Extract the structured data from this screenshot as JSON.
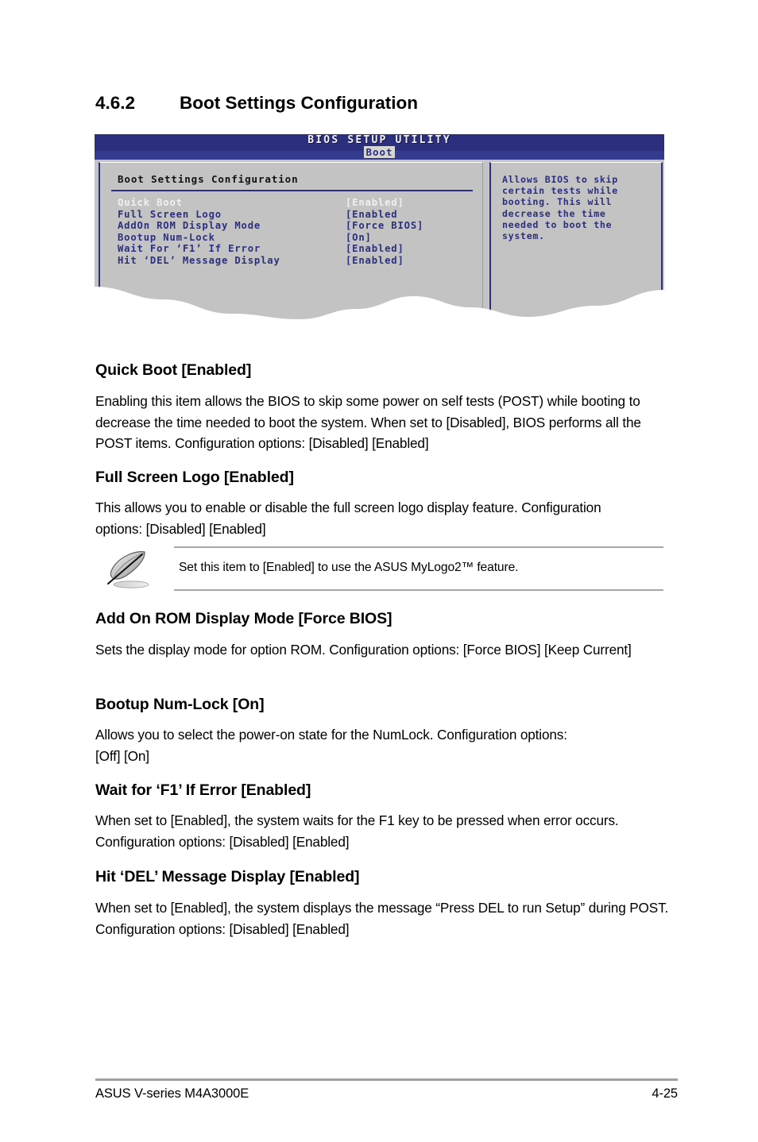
{
  "section": {
    "number": "4.6.2",
    "title": "Boot Settings Configuration"
  },
  "bios": {
    "utility_title": "BIOS SETUP UTILITY",
    "active_tab": "Boot",
    "panel_heading": "Boot Settings Configuration",
    "items": [
      {
        "label": "Quick Boot",
        "value": "[Enabled]",
        "selected": true
      },
      {
        "label": "Full Screen Logo",
        "value": "[Enabled",
        "selected": false
      },
      {
        "label": "AddOn ROM Display Mode",
        "value": "[Force BIOS]",
        "selected": false
      },
      {
        "label": "Bootup Num-Lock",
        "value": "[On]",
        "selected": false
      },
      {
        "label": "Wait For ‘F1’ If Error",
        "value": "[Enabled]",
        "selected": false
      },
      {
        "label": "Hit ‘DEL’ Message Display",
        "value": "[Enabled]",
        "selected": false
      }
    ],
    "help": "Allows BIOS to skip\ncertain tests while\nbooting. This will\ndecrease the time\nneeded to boot the\nsystem.",
    "colors": {
      "title_bar": "#2b2f7e",
      "title_bar_sub": "#343a8e",
      "panel_bg": "#c3c3c3",
      "item_text": "#2b2f7e",
      "selected_text": "#f0f0f0"
    }
  },
  "sections": [
    {
      "heading": "Quick Boot [Enabled]",
      "body": "Enabling this item allows the BIOS to skip some power on self tests (POST) while booting to decrease the time needed to boot the system. When set to [Disabled], BIOS performs all the POST items. Configuration options: [Disabled] [Enabled]"
    },
    {
      "heading": "Full Screen Logo [Enabled]",
      "body": "This allows you to enable or disable the full screen logo display feature. Configuration options: [Disabled] [Enabled]"
    },
    {
      "heading": "Add On ROM Display Mode [Force BIOS]",
      "body": "Sets the display mode for option ROM. Configuration options: [Force BIOS] [Keep Current]"
    },
    {
      "heading": "Bootup Num-Lock [On]",
      "body": "Allows you to select the power-on state for the NumLock. Configuration options: [Off] [On]"
    },
    {
      "heading": "Wait for ‘F1’ If Error [Enabled]",
      "body": "When set to [Enabled], the system waits for the F1 key to be pressed when error occurs. Configuration options: [Disabled] [Enabled]"
    },
    {
      "heading": "Hit ‘DEL’ Message Display [Enabled]",
      "body": "When set to [Enabled], the system displays the message “Press DEL to run Setup” during POST. Configuration options: [Disabled] [Enabled]"
    }
  ],
  "note": {
    "icon": "quill-pen-icon",
    "text": "Set this item to [Enabled] to use the ASUS MyLogo2™ feature."
  },
  "footer": {
    "left": "ASUS V-series M4A3000E",
    "page": "4-25"
  }
}
